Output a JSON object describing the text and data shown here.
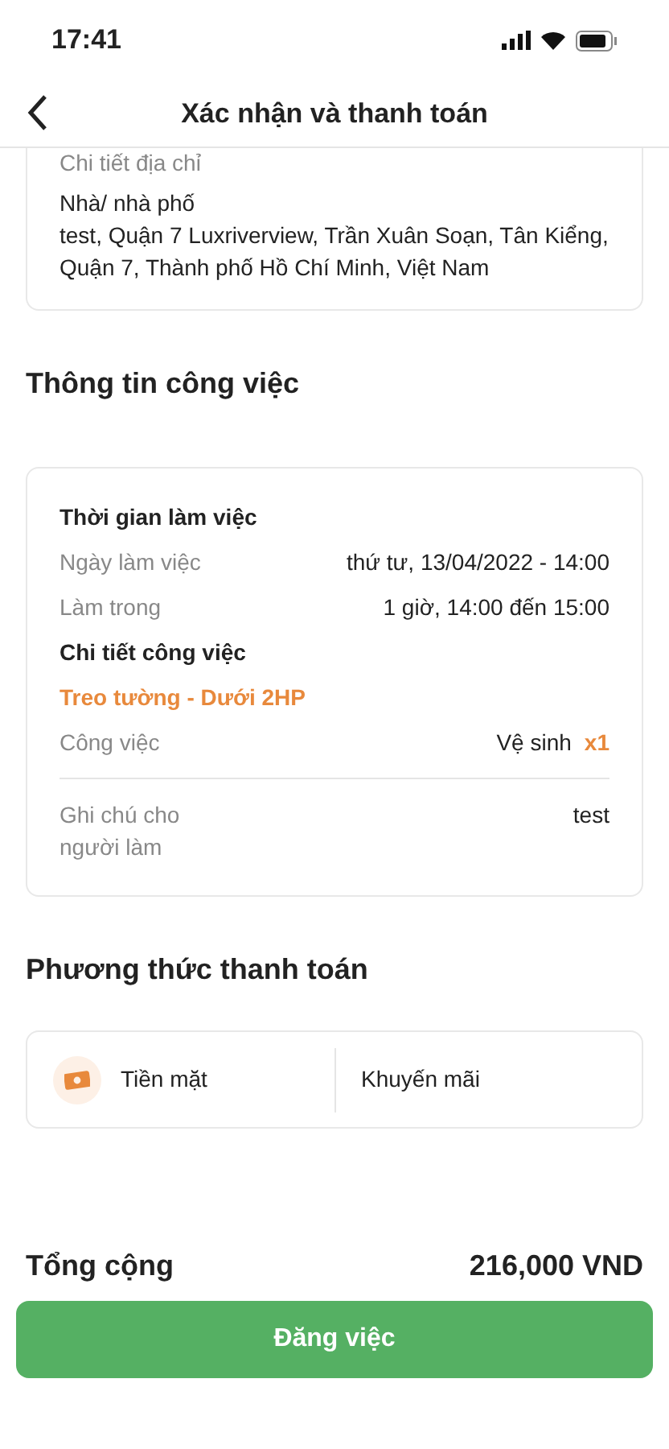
{
  "status_bar": {
    "time": "17:41"
  },
  "header": {
    "title": "Xác nhận và thanh toán"
  },
  "address": {
    "label": "Chi tiết địa chỉ",
    "type": "Nhà/ nhà phố",
    "detail": "test, Quận 7 Luxriverview, Trần Xuân Soạn, Tân Kiểng, Quận 7, Thành phố Hồ Chí Minh, Việt Nam"
  },
  "job_section": {
    "title": "Thông tin công việc",
    "time_heading": "Thời gian làm việc",
    "time_rows": [
      {
        "label": "Ngày làm việc",
        "value": "thứ tư, 13/04/2022 - 14:00"
      },
      {
        "label": "Làm trong",
        "value": "1 giờ, 14:00 đến 15:00"
      }
    ],
    "detail_heading": "Chi tiết công việc",
    "service": "Treo tường - Dưới 2HP",
    "task": {
      "label": "Công việc",
      "value": "Vệ sinh",
      "quantity": "x1"
    },
    "note": {
      "label": "Ghi chú cho người làm",
      "value": "test"
    }
  },
  "payment": {
    "title": "Phương thức thanh toán",
    "method": "Tiền mặt",
    "promo": "Khuyến mãi"
  },
  "total": {
    "label": "Tổng cộng",
    "value": "216,000 VND"
  },
  "submit_button": "Đăng việc"
}
